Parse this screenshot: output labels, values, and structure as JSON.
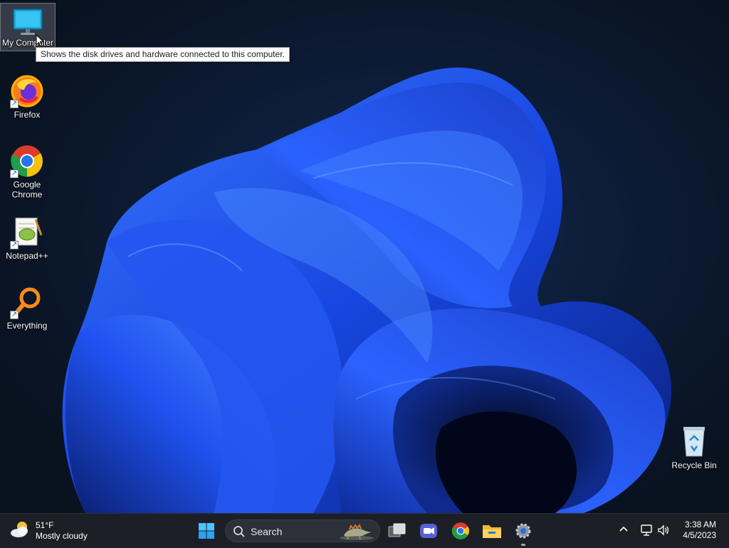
{
  "desktop": {
    "icons": [
      {
        "id": "my-computer",
        "label": "My Computer",
        "selected": true
      },
      {
        "id": "firefox",
        "label": "Firefox",
        "shortcut": true
      },
      {
        "id": "google-chrome",
        "label": "Google Chrome",
        "shortcut": true
      },
      {
        "id": "notepadpp",
        "label": "Notepad++",
        "shortcut": true
      },
      {
        "id": "everything",
        "label": "Everything",
        "shortcut": true
      },
      {
        "id": "recycle-bin",
        "label": "Recycle Bin"
      }
    ],
    "tooltip": "Shows the disk drives and hardware connected to this computer."
  },
  "taskbar": {
    "weather": {
      "temperature": "51°F",
      "condition": "Mostly cloudy",
      "icon": "partly-cloudy-icon"
    },
    "search": {
      "label": "Search",
      "icon": "search-icon"
    },
    "pinned": [
      {
        "id": "start",
        "icon": "windows-logo-icon"
      },
      {
        "id": "task-view",
        "icon": "task-view-icon"
      },
      {
        "id": "teams",
        "icon": "video-chat-icon"
      },
      {
        "id": "chrome",
        "icon": "chrome-icon"
      },
      {
        "id": "file-explorer",
        "icon": "folder-icon"
      },
      {
        "id": "settings",
        "icon": "gear-icon",
        "active": true
      }
    ],
    "tray": {
      "icons": [
        "chevron-up-icon",
        "network-icon",
        "volume-icon"
      ]
    },
    "clock": {
      "time": "3:38 AM",
      "date": "4/5/2023"
    }
  },
  "colors": {
    "accent": "#1a5bff",
    "taskbar": "#1c1f26",
    "tooltip_bg": "#fdfdfd"
  }
}
